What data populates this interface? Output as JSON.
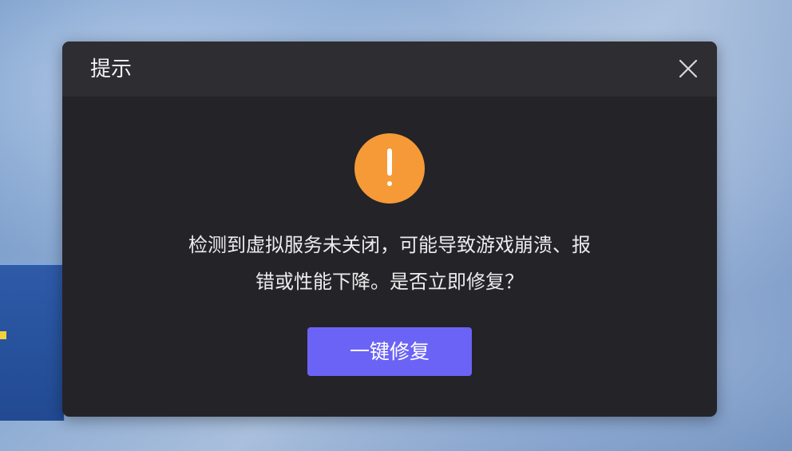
{
  "dialog": {
    "title": "提示",
    "close_icon": "close-icon",
    "warning_icon": "exclamation-circle-icon",
    "message_lines": [
      "检测到虚拟服务未关闭，可能导致游戏崩溃、报",
      "错或性能下降。是否立即修复？"
    ],
    "primary_button_label": "一键修复"
  },
  "colors": {
    "dialog_bg": "#242328",
    "header_bg": "#2e2d32",
    "warning": "#f59a36",
    "primary_button": "#6b63f6"
  }
}
